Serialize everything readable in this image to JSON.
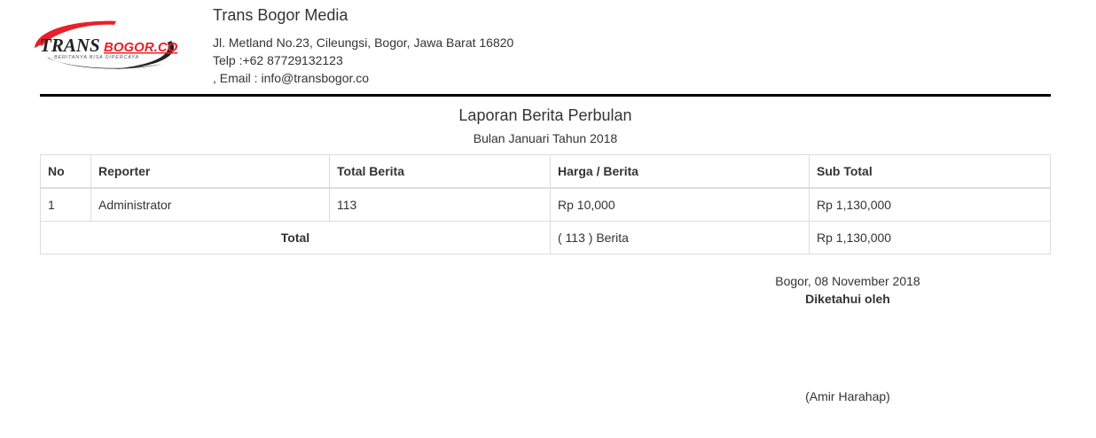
{
  "logo": {
    "text_main": "TRANS",
    "text_accent": "BOGOR.CO",
    "tagline": "BERITANYA BISA DIPERCAYA",
    "accent_color": "#e8202a",
    "dark_color": "#222222"
  },
  "company": {
    "name": "Trans Bogor Media",
    "address": "Jl. Metland No.23, Cileungsi, Bogor, Jawa Barat 16820",
    "phone": "Telp :+62 87729132123",
    "email": ", Email : info@transbogor.co"
  },
  "report": {
    "title": "Laporan Berita Perbulan",
    "subtitle": "Bulan Januari Tahun 2018"
  },
  "table": {
    "headers": {
      "no": "No",
      "reporter": "Reporter",
      "total_berita": "Total Berita",
      "harga": "Harga / Berita",
      "sub_total": "Sub Total"
    },
    "rows": [
      {
        "no": "1",
        "reporter": "Administrator",
        "total_berita": "113",
        "harga": "Rp 10,000",
        "sub_total": "Rp 1,130,000"
      }
    ],
    "footer": {
      "label": "Total",
      "berita": "( 113 ) Berita",
      "sub_total": "Rp 1,130,000"
    }
  },
  "signature": {
    "place_date": "Bogor, 08 November 2018",
    "known_by": "Diketahui oleh",
    "name": "(Amir Harahap)"
  }
}
